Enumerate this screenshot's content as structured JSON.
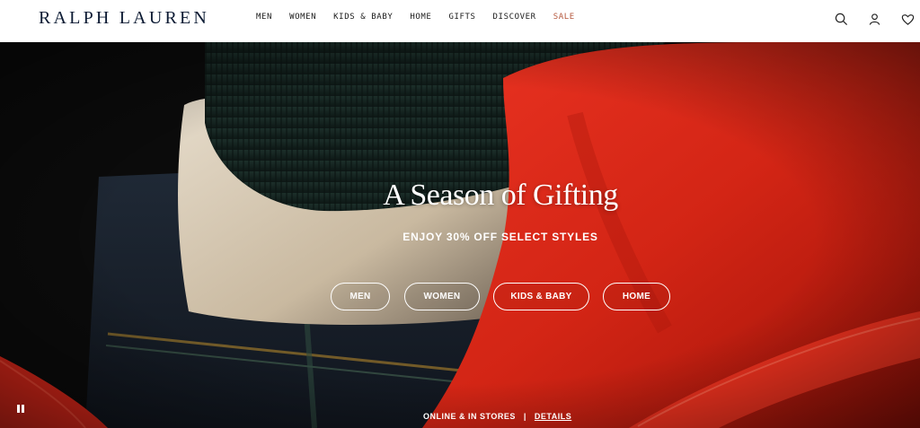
{
  "brand": {
    "logo_text": "RALPH LAUREN"
  },
  "nav": {
    "items": [
      {
        "label": "MEN"
      },
      {
        "label": "WOMEN"
      },
      {
        "label": "KIDS & BABY"
      },
      {
        "label": "HOME"
      },
      {
        "label": "GIFTS"
      },
      {
        "label": "DISCOVER"
      },
      {
        "label": "SALE"
      }
    ]
  },
  "header_icons": [
    "search-icon",
    "account-icon",
    "wishlist-heart-icon"
  ],
  "hero": {
    "title": "A Season of Gifting",
    "subtitle": "ENJOY 30% OFF SELECT STYLES",
    "ctas": [
      {
        "label": "MEN"
      },
      {
        "label": "WOMEN"
      },
      {
        "label": "KIDS & BABY"
      },
      {
        "label": "HOME"
      }
    ],
    "footer_text": "ONLINE & IN STORES",
    "footer_separator": "|",
    "footer_link": "DETAILS"
  },
  "colors": {
    "sale": "#b4563b",
    "logo": "#0b1a33",
    "hero_red": "#d8261a"
  }
}
